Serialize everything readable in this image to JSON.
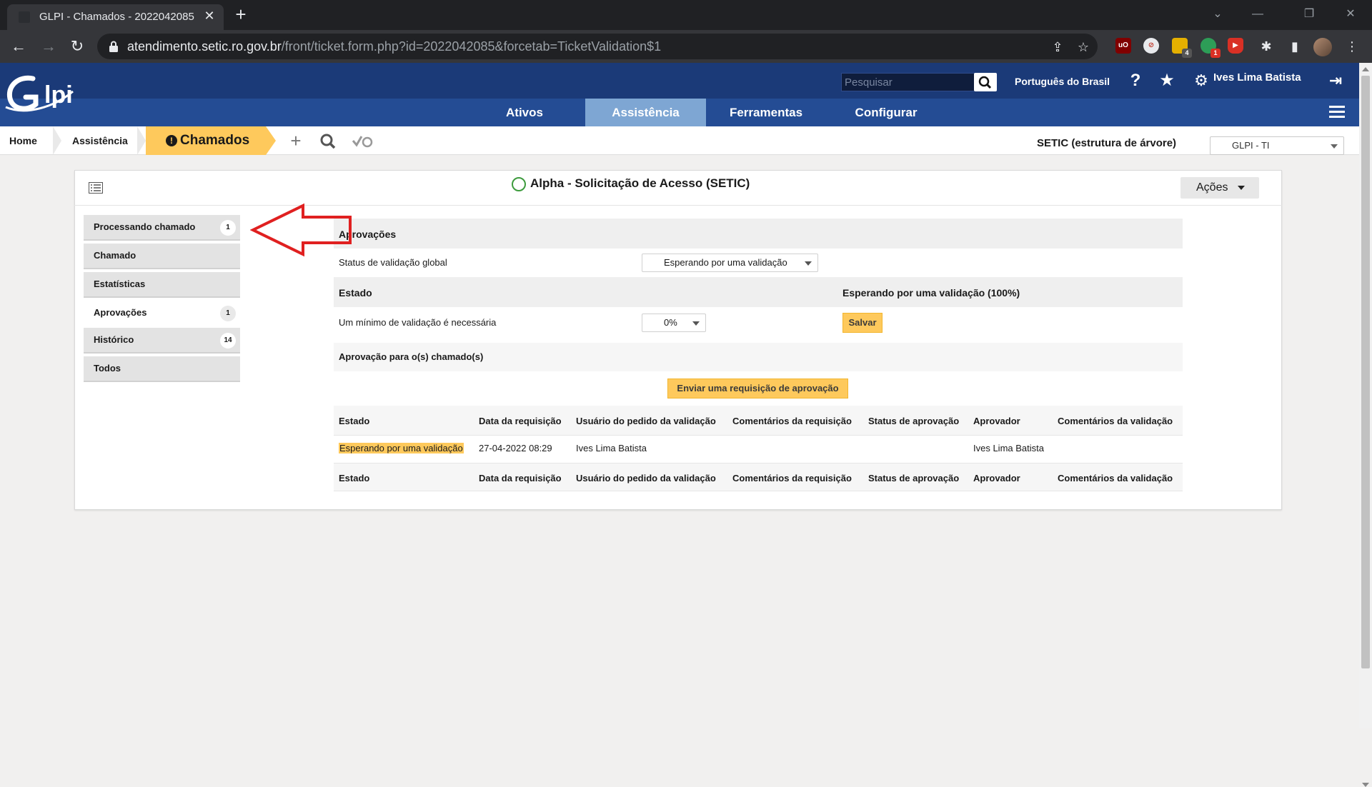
{
  "browser": {
    "tab_title": "GLPI - Chamados - 2022042085",
    "url_host": "atendimento.setic.ro.gov.br",
    "url_path": "/front/ticket.form.php?id=2022042085&forcetab=TicketValidation$1",
    "ext_badge_1": "4",
    "ext_badge_2": "1"
  },
  "header": {
    "search_placeholder": "Pesquisar",
    "language": "Português do Brasil",
    "user": "Ives Lima Batista",
    "logo_text": "Glpi"
  },
  "menu": [
    {
      "label": "Ativos"
    },
    {
      "label": "Assistência"
    },
    {
      "label": "Ferramentas"
    },
    {
      "label": "Configurar"
    }
  ],
  "breadcrumb": {
    "home": "Home",
    "section": "Assistência",
    "current": "Chamados"
  },
  "entity": {
    "label": "SETIC (estrutura de árvore)",
    "selected": "GLPI - TI"
  },
  "ticket": {
    "title": "Alpha - Solicitação de Acesso (SETIC)",
    "actions_label": "Ações"
  },
  "side_tabs": [
    {
      "label": "Processando chamado",
      "count": "1"
    },
    {
      "label": "Chamado",
      "count": ""
    },
    {
      "label": "Estatísticas",
      "count": ""
    },
    {
      "label": "Aprovações",
      "count": "1"
    },
    {
      "label": "Histórico",
      "count": "14"
    },
    {
      "label": "Todos",
      "count": ""
    }
  ],
  "approvals": {
    "section_title": "Aprovações",
    "global_status_label": "Status de validação global",
    "global_status_value": "Esperando por uma validação",
    "estado_label": "Estado",
    "estado_value": "Esperando por uma validação (100%)",
    "min_validation_label": "Um mínimo de validação é necessária",
    "min_validation_value": "0%",
    "save_label": "Salvar",
    "for_tickets_title": "Aprovação para o(s) chamado(s)",
    "send_request_label": "Enviar uma requisição de aprovação",
    "columns": [
      "Estado",
      "Data da requisição",
      "Usuário do pedido da validação",
      "Comentários da requisição",
      "Status de aprovação",
      "Aprovador",
      "Comentários da validação"
    ],
    "rows": [
      [
        "Esperando por uma validação",
        "27-04-2022 08:29",
        "Ives Lima Batista",
        "",
        "",
        "Ives Lima Batista",
        ""
      ]
    ]
  },
  "colors": {
    "header_dark": "#1b3a78",
    "menu_blue": "#244c94",
    "menu_active": "#7ea6d3",
    "accent_yellow": "#fec95c",
    "annotation_red": "#e02020"
  }
}
